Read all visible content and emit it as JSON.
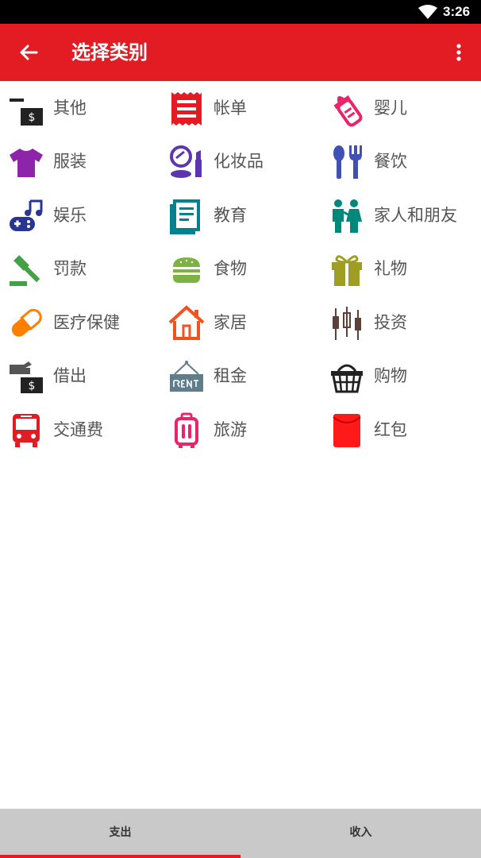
{
  "status_bar": {
    "time": "3:26"
  },
  "app_bar": {
    "title": "选择类别"
  },
  "categories": [
    {
      "label": "其他",
      "icon": "cash-icon",
      "color": "#222222"
    },
    {
      "label": "帐单",
      "icon": "bill-icon",
      "color": "#e31b23"
    },
    {
      "label": "婴儿",
      "icon": "baby-bottle-icon",
      "color": "#e8246b"
    },
    {
      "label": "服装",
      "icon": "shirt-icon",
      "color": "#8e24aa"
    },
    {
      "label": "化妆品",
      "icon": "cosmetics-icon",
      "color": "#5e35b1"
    },
    {
      "label": "餐饮",
      "icon": "utensils-icon",
      "color": "#3f51b5"
    },
    {
      "label": "娱乐",
      "icon": "game-music-icon",
      "color": "#283593"
    },
    {
      "label": "教育",
      "icon": "book-icon",
      "color": "#00838f"
    },
    {
      "label": "家人和朋友",
      "icon": "family-icon",
      "color": "#00897b"
    },
    {
      "label": "罚款",
      "icon": "gavel-icon",
      "color": "#43a047"
    },
    {
      "label": "食物",
      "icon": "burger-icon",
      "color": "#7cb342"
    },
    {
      "label": "礼物",
      "icon": "gift-icon",
      "color": "#9e9d24"
    },
    {
      "label": "医疗保健",
      "icon": "pill-icon",
      "color": "#ff7f00"
    },
    {
      "label": "家居",
      "icon": "house-icon",
      "color": "#f4511e"
    },
    {
      "label": "投资",
      "icon": "candlestick-icon",
      "color": "#5d4037"
    },
    {
      "label": "借出",
      "icon": "lend-icon",
      "color": "#555555"
    },
    {
      "label": "租金",
      "icon": "rent-sign-icon",
      "color": "#607d8b"
    },
    {
      "label": "购物",
      "icon": "basket-icon",
      "color": "#222222"
    },
    {
      "label": "交通费",
      "icon": "bus-icon",
      "color": "#e31b23"
    },
    {
      "label": "旅游",
      "icon": "luggage-icon",
      "color": "#e8246b"
    },
    {
      "label": "红包",
      "icon": "red-envelope-icon",
      "color": "#ff1a1a"
    }
  ],
  "tabs": [
    {
      "label": "支出",
      "selected": true
    },
    {
      "label": "收入",
      "selected": false
    }
  ],
  "colors": {
    "accent": "#e31b23",
    "tab_bar": "#c9c9c9"
  }
}
